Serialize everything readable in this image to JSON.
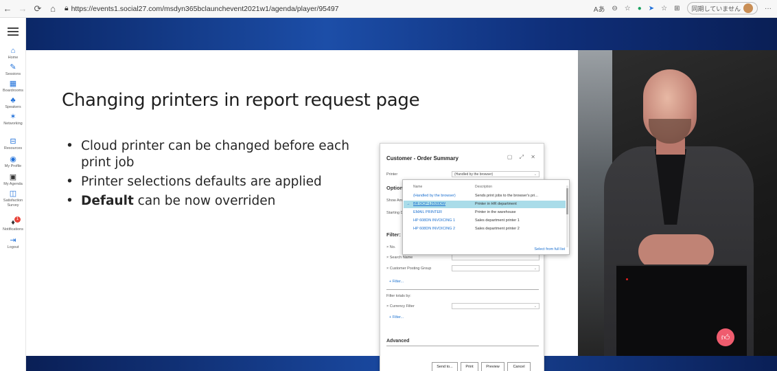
{
  "browser": {
    "url": "https://events1.social27.com/msdyn365bclaunchevent2021w1/agenda/player/95497",
    "sync_label": "同期していません"
  },
  "sidebar": {
    "items": [
      {
        "label": "Home",
        "icon": "home-icon"
      },
      {
        "label": "Sessions",
        "icon": "pencil-icon"
      },
      {
        "label": "Boardrooms",
        "icon": "calendar-icon"
      },
      {
        "label": "Speakers",
        "icon": "speaker-icon"
      },
      {
        "label": "Networking",
        "icon": "network-icon"
      },
      {
        "label": "Resources",
        "icon": "resources-icon"
      },
      {
        "label": "My Profile",
        "icon": "profile-icon"
      },
      {
        "label": "My Agenda",
        "icon": "agenda-icon"
      },
      {
        "label": "Satisfaction Survey",
        "icon": "survey-icon"
      },
      {
        "label": "Notifications",
        "icon": "bell-icon",
        "badge": "1"
      },
      {
        "label": "Logout",
        "icon": "logout-icon"
      }
    ]
  },
  "slide": {
    "title": "Changing printers in report request page",
    "bullets": [
      {
        "text": "Cloud printer can be changed before each print job"
      },
      {
        "text": "Printer selections defaults are applied"
      },
      {
        "bold": "Default",
        "text": " can be now overriden"
      }
    ]
  },
  "dialog": {
    "title": "Customer - Order Summary",
    "printer_label": "Printer",
    "printer_value": "(Handled by the browser)",
    "options_label": "Option",
    "show_label": "Show Am",
    "starting_label": "Starting D",
    "filter_label": "Filter: C",
    "no_label": "× No.",
    "search_name_label": "× Search Name",
    "posting_group_label": "× Customer Posting Group",
    "add_filter": "+ Filter...",
    "filter_totals_label": "Filter totals by:",
    "currency_label": "× Currency Filter",
    "add_filter2": "+ Filter...",
    "advanced_label": "Advanced",
    "buttons": {
      "send": "Send to...",
      "print": "Print",
      "preview": "Preview",
      "cancel": "Cancel"
    }
  },
  "dropdown": {
    "col_name": "Name",
    "col_desc": "Description",
    "rows": [
      {
        "name": "(Handled by the browser)",
        "desc": "Sends print jobs to the browser's pri..."
      },
      {
        "name": "BR DCP-L2530DW",
        "desc": "Printer in HR department"
      },
      {
        "name": "EMAIL PRINTER",
        "desc": "Printer in the warehouse"
      },
      {
        "name": "HP 608DN INVOICING 1",
        "desc": "Sales department printer 1"
      },
      {
        "name": "HP 608DN INVOICING 2",
        "desc": "Sales department printer 2"
      }
    ],
    "select_full": "Select from full list"
  },
  "colors": {
    "accent": "#1a6fcf",
    "selected_row": "#a9dce9",
    "like_button": "#ef5c6e"
  }
}
